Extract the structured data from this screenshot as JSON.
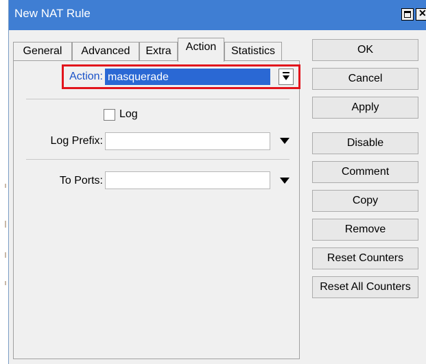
{
  "window": {
    "title": "New NAT Rule"
  },
  "tabs": [
    {
      "label": "General"
    },
    {
      "label": "Advanced"
    },
    {
      "label": "Extra"
    },
    {
      "label": "Action"
    },
    {
      "label": "Statistics"
    }
  ],
  "active_tab": "Action",
  "form": {
    "action": {
      "label": "Action:",
      "value": "masquerade"
    },
    "log": {
      "label": "Log",
      "checked": false
    },
    "log_prefix": {
      "label": "Log Prefix:",
      "value": ""
    },
    "to_ports": {
      "label": "To Ports:",
      "value": ""
    }
  },
  "buttons": {
    "ok": "OK",
    "cancel": "Cancel",
    "apply": "Apply",
    "disable": "Disable",
    "comment": "Comment",
    "copy": "Copy",
    "remove": "Remove",
    "reset_counters": "Reset Counters",
    "reset_all_counters": "Reset All Counters"
  },
  "colors": {
    "titlebar": "#3f7ed3",
    "highlight_border": "#e2141c",
    "selection": "#2a68d4",
    "label_accent": "#1a52c8"
  }
}
